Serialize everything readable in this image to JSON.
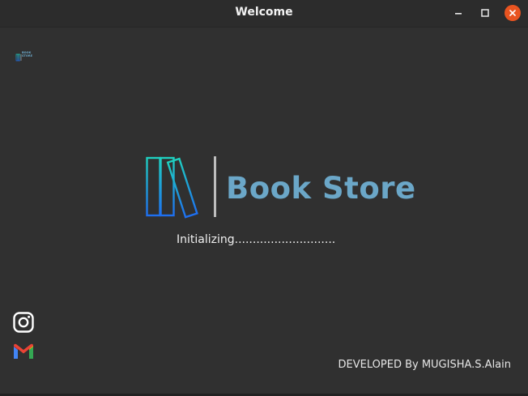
{
  "window": {
    "title": "Welcome",
    "controls": {
      "minimize_icon": "minimize-icon",
      "maximize_icon": "maximize-icon",
      "close_icon": "close-icon",
      "close_color": "#e95420"
    }
  },
  "logo": {
    "app_name": "Book Store",
    "icon": "bookshelf-icon",
    "accent_gradient": [
      "#1fd0c0",
      "#1e6ff0"
    ],
    "title_color": "#6ba7c8",
    "mini_logo_text": "BOOK STORE"
  },
  "status": {
    "text": "Initializing............................"
  },
  "social": [
    {
      "name": "instagram",
      "icon": "instagram-icon"
    },
    {
      "name": "gmail",
      "icon": "gmail-icon"
    }
  ],
  "footer": {
    "credit": "DEVELOPED By MUGISHA.S.Alain"
  }
}
